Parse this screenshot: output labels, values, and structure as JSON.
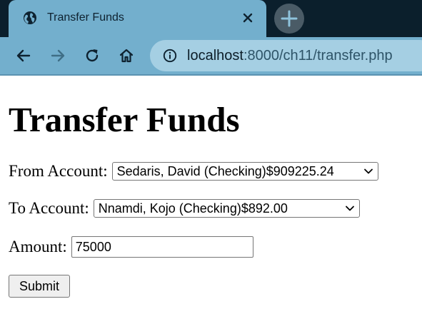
{
  "browser": {
    "tab": {
      "title": "Transfer Funds",
      "favicon": "globe-icon",
      "close": "close-icon"
    },
    "new_tab": "plus-icon",
    "nav": [
      "back-arrow-icon",
      "forward-arrow-icon",
      "reload-icon",
      "home-icon"
    ],
    "omnibox": {
      "info": "info-icon",
      "host": "localhost",
      "path": ":8000/ch11/transfer.php"
    },
    "colors": {
      "tabstrip": "#0b1f2c",
      "toolbar": "#73afcd",
      "omnibox": "#a5cfe3"
    }
  },
  "page": {
    "title": "Transfer Funds",
    "form": {
      "from_label": "From Account:",
      "from_selected": "Sedaris, David (Checking)$909225.24",
      "to_label": "To Account:",
      "to_selected": "Nnamdi, Kojo (Checking)$892.00",
      "amount_label": "Amount:",
      "amount_value": "75000",
      "submit_label": "Submit"
    }
  }
}
